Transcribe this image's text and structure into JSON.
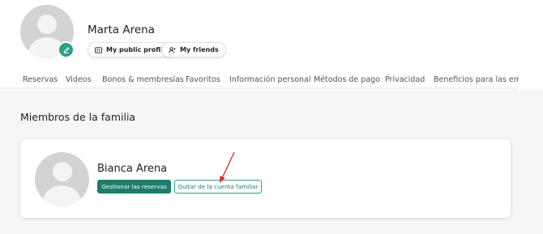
{
  "profile": {
    "name": "Marta Arena",
    "public_profile_label": "My public profile",
    "friends_label": "My friends"
  },
  "tabs": [
    {
      "label": "Reservas"
    },
    {
      "label": "Videos"
    },
    {
      "label": "Bonos & membresías"
    },
    {
      "label": "Favoritos"
    },
    {
      "label": "Información personal"
    },
    {
      "label": "Métodos de pago"
    },
    {
      "label": "Privacidad"
    },
    {
      "label": "Beneficios para las emp"
    }
  ],
  "family": {
    "title": "Miembros de la familia",
    "members": [
      {
        "name": "Bianca Arena",
        "manage_label": "Gestionar las reservas",
        "remove_label": "Quitar de la cuenta familiar"
      }
    ]
  },
  "colors": {
    "accent": "#1d7d6c",
    "accent_light": "#2b9e8c",
    "annotation_arrow": "#d62828"
  },
  "icons": {
    "edit": "pencil-icon",
    "profile": "id-card-icon",
    "friends": "add-person-icon"
  }
}
